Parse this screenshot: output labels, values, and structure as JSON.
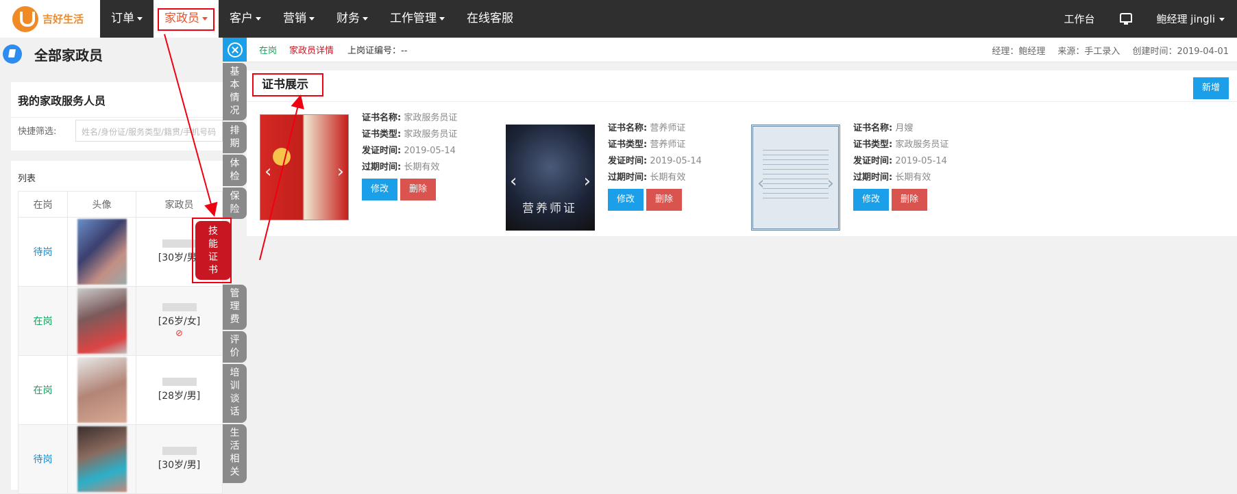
{
  "brand": {
    "name": "吉好生活"
  },
  "nav": {
    "items": [
      {
        "label": "订单",
        "caret": true
      },
      {
        "label": "家政员",
        "caret": true,
        "active": true
      },
      {
        "label": "客户",
        "caret": true
      },
      {
        "label": "营销",
        "caret": true
      },
      {
        "label": "财务",
        "caret": true
      },
      {
        "label": "工作管理",
        "caret": true
      },
      {
        "label": "在线客服",
        "caret": false
      }
    ],
    "workbench": "工作台",
    "user": "鲍经理  jingli"
  },
  "left": {
    "title": "全部家政员",
    "card_title": "我的家政服务人员",
    "filter_label": "快捷筛选:",
    "filter_placeholder": "姓名/身份证/服务类型/籍贯/手机号码",
    "list_label": "列表",
    "columns": [
      "在岗",
      "头像",
      "家政员"
    ],
    "rows": [
      {
        "status": "待岗",
        "info": "[30岁/男]",
        "banned": false
      },
      {
        "status": "在岗",
        "info": "[26岁/女]",
        "banned": true
      },
      {
        "status": "在岗",
        "info": "[28岁/男]",
        "banned": false
      },
      {
        "status": "待岗",
        "info": "[30岁/男]",
        "banned": false
      }
    ]
  },
  "tabs": [
    "基本情况",
    "排期",
    "体检",
    "保险",
    "技能证书",
    "管理费",
    "评价",
    "培训谈话",
    "生活相关"
  ],
  "active_tab": "技能证书",
  "infobar": {
    "status": "在岗",
    "detail": "家政员详情",
    "code": "上岗证编号：--",
    "manager": "经理：鲍经理",
    "source": "来源：手工录入",
    "created": "创建时间：2019-04-01"
  },
  "panel": {
    "title": "证书展示",
    "add": "新增",
    "keys": {
      "name": "证书名称:",
      "type": "证书类型:",
      "issued": "发证时间:",
      "expire": "过期时间:"
    },
    "edit": "修改",
    "delete": "删除",
    "certs": [
      {
        "name": "家政服务员证",
        "type": "家政服务员证",
        "issued": "2019-05-14",
        "expire": "长期有效"
      },
      {
        "name": "营养师证",
        "type": "营养师证",
        "issued": "2019-05-14",
        "expire": "长期有效"
      },
      {
        "name": "月嫂",
        "type": "家政服务员证",
        "issued": "2019-05-14",
        "expire": "长期有效"
      }
    ]
  },
  "colors": {
    "accent": "#1a9fe8",
    "danger": "#d9534f",
    "brand": "#f08a24",
    "active_tab": "#c81623"
  }
}
